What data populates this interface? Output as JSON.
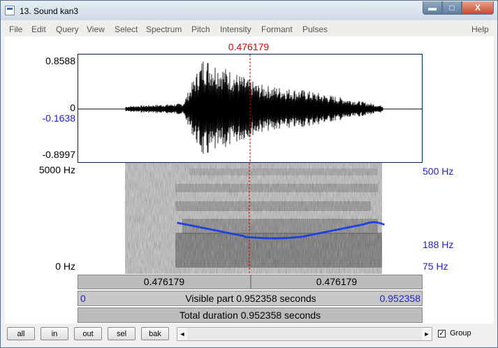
{
  "window": {
    "title": "13. Sound kan3",
    "minimize_glyph": "▬",
    "maximize_glyph": "□",
    "close_glyph": "X"
  },
  "menu": [
    "File",
    "Edit",
    "Query",
    "View",
    "Select",
    "Spectrum",
    "Pitch",
    "Intensity",
    "Formant",
    "Pulses",
    "Help"
  ],
  "cursor_time_label": "0.476179",
  "waveform": {
    "ymax_label": "0.8588",
    "zero_label": "0",
    "cursor_value_label": "-0.1638",
    "ymin_label": "-0.8997"
  },
  "spectrogram": {
    "top_freq_label": "5000 Hz",
    "bottom_freq_label": "0 Hz"
  },
  "pitch_axis": {
    "top_label": "500 Hz",
    "value_label": "188 Hz",
    "bottom_label": "75 Hz"
  },
  "selection": {
    "left_label": "0.476179",
    "right_label": "0.476179"
  },
  "visible_part": {
    "start": "0",
    "text": "Visible part 0.952358 seconds",
    "end": "0.952358"
  },
  "total_duration": "Total duration 0.952358 seconds",
  "buttons": {
    "all": "all",
    "in": "in",
    "out": "out",
    "sel": "sel",
    "bak": "bak"
  },
  "group": {
    "label": "Group",
    "checked_glyph": "✓"
  },
  "icons": {
    "scroll_left": "◄",
    "scroll_right": "►"
  },
  "colors": {
    "cursor": "#e00000",
    "pitch": "#1a3fe0",
    "axis_labels": "#2222cc"
  }
}
